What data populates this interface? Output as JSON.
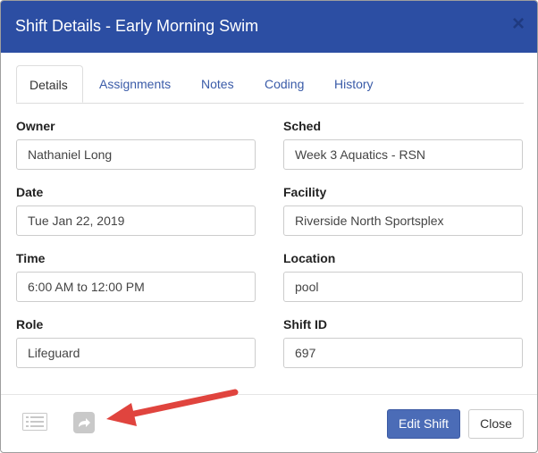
{
  "dialog": {
    "title": "Shift Details - Early Morning Swim",
    "close_symbol": "×"
  },
  "tabs": [
    {
      "label": "Details",
      "active": true
    },
    {
      "label": "Assignments",
      "active": false
    },
    {
      "label": "Notes",
      "active": false
    },
    {
      "label": "Coding",
      "active": false
    },
    {
      "label": "History",
      "active": false
    }
  ],
  "fields": {
    "owner": {
      "label": "Owner",
      "value": "Nathaniel Long"
    },
    "sched": {
      "label": "Sched",
      "value": "Week 3 Aquatics - RSN"
    },
    "date": {
      "label": "Date",
      "value": "Tue Jan 22, 2019"
    },
    "facility": {
      "label": "Facility",
      "value": "Riverside North Sportsplex"
    },
    "time": {
      "label": "Time",
      "value": "6:00 AM to 12:00 PM"
    },
    "location": {
      "label": "Location",
      "value": "pool"
    },
    "role": {
      "label": "Role",
      "value": "Lifeguard"
    },
    "shift_id": {
      "label": "Shift ID",
      "value": "697"
    }
  },
  "footer": {
    "edit_label": "Edit Shift",
    "close_label": "Close",
    "icons": [
      "list-icon",
      "share-forward-icon"
    ]
  },
  "colors": {
    "header": "#2c4ea3",
    "primary_button": "#4b6cb7",
    "arrow": "#e0443e",
    "tab_link": "#3a5ba8"
  }
}
